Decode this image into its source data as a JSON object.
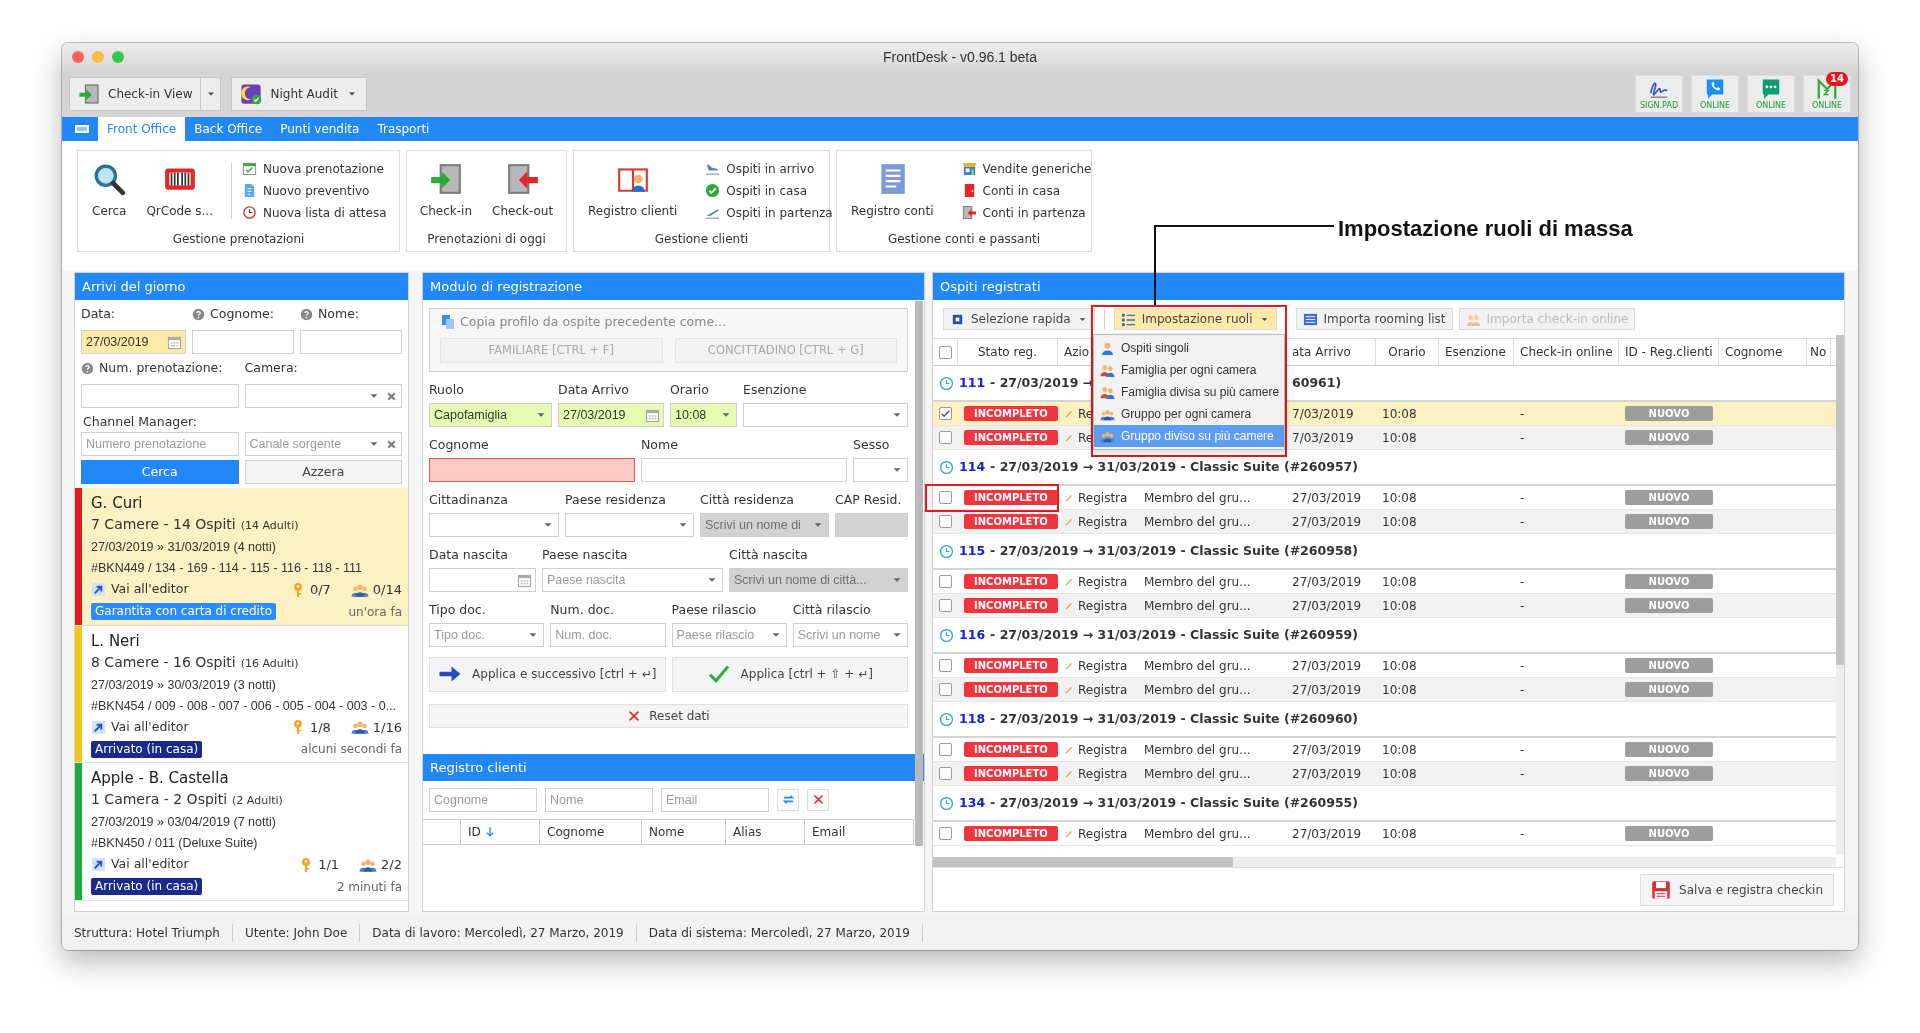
{
  "window": {
    "title": "FrontDesk - v0.96.1 beta"
  },
  "toolbar": {
    "left": [
      {
        "label": "Check-in View",
        "kind": "split"
      },
      {
        "label": "Night Audit",
        "kind": "dropdown"
      }
    ],
    "right": [
      {
        "label": "SIGN.PAD"
      },
      {
        "label": "ONLINE"
      },
      {
        "label": "ONLINE"
      },
      {
        "label": "ONLINE",
        "badge": "14"
      }
    ]
  },
  "tabs": [
    {
      "label": "Front Office",
      "selected": true
    },
    {
      "label": "Back Office",
      "selected": false
    },
    {
      "label": "Punti vendita",
      "selected": false
    },
    {
      "label": "Trasporti",
      "selected": false
    }
  ],
  "ribbon": [
    {
      "title": "Gestione prenotazioni",
      "large": [
        "Cerca",
        "QrCode s..."
      ],
      "small": [
        "Nuova prenotazione",
        "Nuovo preventivo",
        "Nuova lista di attesa"
      ]
    },
    {
      "title": "Prenotazioni di oggi",
      "large": [
        "Check-in",
        "Check-out"
      ]
    },
    {
      "title": "Gestione clienti",
      "large": [
        "Registro clienti"
      ],
      "small": [
        "Ospiti in arrivo",
        "Ospiti in casa",
        "Ospiti in partenza"
      ]
    },
    {
      "title": "Gestione conti e passanti",
      "large": [
        "Registro conti"
      ],
      "small": [
        "Vendite generiche",
        "Conti in casa",
        "Conti in partenza"
      ]
    }
  ],
  "annotation": {
    "text": "Impostazione ruoli di massa"
  },
  "arrivals": {
    "title": "Arrivi del giorno",
    "filters": [
      {
        "label": "Data:",
        "kind": "date",
        "value": "27/03/2019",
        "help": false,
        "highlighted": true
      },
      {
        "label": "Cognome:",
        "kind": "text",
        "help": true,
        "highlighted": false
      },
      {
        "label": "Nome:",
        "kind": "text",
        "help": true,
        "highlighted": false
      },
      {
        "label": "Num. prenotazione:",
        "kind": "text",
        "help": true,
        "highlighted": false
      },
      {
        "label": "Camera:",
        "kind": "select-clear",
        "help": false,
        "highlighted": false
      }
    ],
    "channel": {
      "label": "Channel Manager:",
      "fields": [
        {
          "kind": "text",
          "placeholder": "Numero prenotazione"
        },
        {
          "kind": "select-clear",
          "placeholder": "Canale sorgente"
        }
      ]
    },
    "buttons": [
      {
        "label": "Cerca",
        "primary": true
      },
      {
        "label": "Azzera",
        "primary": false
      }
    ],
    "bookings": [
      {
        "name": "G. Curi",
        "rooms": "7 Camere - 14 Ospiti",
        "adults": "(14 Adulti)",
        "dates": "27/03/2019 » 31/03/2019 (4 notti)",
        "booking": "#BKN449 / 134 - 169 - 114 - 115 - 116 - 118 - 111",
        "link": "Vai all'editor",
        "keys": "0/7",
        "guests": "0/14",
        "status": {
          "text": "Garantita con carta di credito",
          "color": "#2b8cff"
        },
        "ago": "un'ora fa",
        "color": "#e01b1b",
        "selected": true
      },
      {
        "name": "L. Neri",
        "rooms": "8 Camere - 16 Ospiti",
        "adults": "(16 Adulti)",
        "dates": "27/03/2019 » 30/03/2019 (3 notti)",
        "booking": "#BKN454 / 009 - 008 - 007 - 006 - 005 - 004 - 003 - 0...",
        "link": "Vai all'editor",
        "keys": "1/8",
        "guests": "1/16",
        "status": {
          "text": "Arrivato (in casa)",
          "color": "#1a2a8c"
        },
        "ago": "alcuni secondi fa",
        "color": "#f5c518",
        "selected": false
      },
      {
        "name": "Apple - B. Castella",
        "rooms": "1 Camera - 2 Ospiti",
        "adults": "(2 Adulti)",
        "dates": "27/03/2019 » 03/04/2019 (7 notti)",
        "booking": "#BKN450 / 011 (Deluxe Suite)",
        "link": "Vai all'editor",
        "keys": "1/1",
        "guests": "2/2",
        "status": {
          "text": "Arrivato (in casa)",
          "color": "#1a2a8c"
        },
        "ago": "2 minuti fa",
        "color": "#1faa3c",
        "selected": false
      }
    ]
  },
  "registration": {
    "title": "Modulo di registrazione",
    "copy_legend": "Copia profilo da ospite precedente come...",
    "copy_buttons": [
      {
        "label": "FAMILIARE [CTRL + F]",
        "disabled": true
      },
      {
        "label": "CONCITTADINO [CTRL + G]",
        "disabled": true
      }
    ],
    "rows": [
      {
        "fields": [
          {
            "label": "Ruolo",
            "kind": "select",
            "value": "Capofamiglia",
            "highlighted": true,
            "invalid": false,
            "disabled": false
          },
          {
            "label": "Data Arrivo",
            "kind": "date",
            "value": "27/03/2019",
            "highlighted": true,
            "invalid": false,
            "disabled": false
          },
          {
            "label": "Orario",
            "kind": "select",
            "value": "10:08",
            "highlighted": true,
            "invalid": false,
            "disabled": false
          },
          {
            "label": "Esenzione",
            "kind": "select",
            "highlighted": false,
            "invalid": false,
            "disabled": false
          }
        ]
      },
      {
        "fields": [
          {
            "label": "Cognome",
            "kind": "text",
            "highlighted": false,
            "invalid": true,
            "disabled": false
          },
          {
            "label": "Nome",
            "kind": "text",
            "highlighted": false,
            "invalid": false,
            "disabled": false
          },
          {
            "label": "Sesso",
            "kind": "select",
            "highlighted": false,
            "invalid": false,
            "disabled": false
          }
        ]
      },
      {
        "fields": [
          {
            "label": "Cittadinanza",
            "kind": "select",
            "highlighted": false,
            "invalid": false,
            "disabled": false
          },
          {
            "label": "Paese residenza",
            "kind": "select",
            "highlighted": false,
            "invalid": false,
            "disabled": false
          },
          {
            "label": "Città residenza",
            "kind": "select",
            "placeholder": "Scrivi un nome di",
            "highlighted": false,
            "invalid": false,
            "disabled": true
          },
          {
            "label": "CAP Resid.",
            "kind": "text",
            "highlighted": false,
            "invalid": false,
            "disabled": true
          }
        ]
      },
      {
        "fields": [
          {
            "label": "Data nascita",
            "kind": "date",
            "highlighted": false,
            "invalid": false,
            "disabled": false
          },
          {
            "label": "Paese nascita",
            "kind": "select",
            "placeholder": "Paese nascita",
            "highlighted": false,
            "invalid": false,
            "disabled": false
          },
          {
            "label": "Città nascita",
            "kind": "select",
            "placeholder": "Scrivi un nome di città...",
            "highlighted": false,
            "invalid": false,
            "disabled": true
          }
        ]
      },
      {
        "fields": [
          {
            "label": "Tipo doc.",
            "kind": "select",
            "placeholder": "Tipo doc.",
            "highlighted": false,
            "invalid": false,
            "disabled": false
          },
          {
            "label": "Num. doc.",
            "kind": "text",
            "placeholder": "Num. doc.",
            "highlighted": false,
            "invalid": false,
            "disabled": false
          },
          {
            "label": "Paese rilascio",
            "kind": "select",
            "placeholder": "Paese rilascio",
            "highlighted": false,
            "invalid": false,
            "disabled": false
          },
          {
            "label": "Città rilascio",
            "kind": "select",
            "placeholder": "Scrivi un nome",
            "highlighted": false,
            "invalid": false,
            "disabled": false
          }
        ]
      }
    ],
    "apply_buttons": [
      {
        "label": "Applica e successivo [ctrl + ↵]"
      },
      {
        "label": "Applica [ctrl + ⇧ + ↵]"
      }
    ],
    "reset": "Reset dati"
  },
  "clients": {
    "title": "Registro clienti",
    "filters": [
      {
        "placeholder": "Cognome"
      },
      {
        "placeholder": "Nome"
      },
      {
        "placeholder": "Email"
      }
    ],
    "columns": [
      "ID",
      "Cognome",
      "Nome",
      "Alias",
      "Email"
    ]
  },
  "guests": {
    "title": "Ospiti registrati",
    "toolbar": [
      {
        "label": "Selezione rapida",
        "kind": "dropdown",
        "open": false,
        "disabled": false
      },
      {
        "label": "Impostazione ruoli",
        "kind": "dropdown",
        "open": true,
        "disabled": false
      },
      {
        "label": "Importa rooming list",
        "kind": "button",
        "open": false,
        "disabled": false
      },
      {
        "label": "Importa check-in online",
        "kind": "button",
        "open": false,
        "disabled": true
      }
    ],
    "role_menu": [
      {
        "label": "Ospiti singoli",
        "selected": false
      },
      {
        "label": "Famiglia per ogni camera",
        "selected": false
      },
      {
        "label": "Famiglia divisa su più camere",
        "selected": false
      },
      {
        "label": "Gruppo per ogni camera",
        "selected": false
      },
      {
        "label": "Gruppo diviso su più camere",
        "selected": true
      }
    ],
    "select_all": false,
    "columns": [
      "Stato reg.",
      "Azio",
      "ata Arrivo",
      "Orario",
      "Esenzione",
      "Check-in online",
      "ID - Reg.clienti",
      "Cognome",
      "No"
    ],
    "groups": [
      {
        "room": "111",
        "title": "- 27/03/2019 →",
        "title_tail": "60961)",
        "rows": [
          {
            "checked": true,
            "selected": true,
            "status": "INCOMPLETO",
            "action": "Re",
            "date": "7/03/2019",
            "time": "10:08",
            "checkin": "-",
            "id": "NUOVO"
          },
          {
            "checked": false,
            "selected": false,
            "status": "INCOMPLETO",
            "action": "Re",
            "date": "7/03/2019",
            "time": "10:08",
            "checkin": "-",
            "id": "NUOVO"
          }
        ]
      },
      {
        "room": "114",
        "title": "- 27/03/2019 → 31/03/2019 - Classic Suite (#260957)",
        "rows": [
          {
            "checked": false,
            "selected": false,
            "status": "INCOMPLETO",
            "action": "Registra",
            "role": "Membro del gru...",
            "date": "27/03/2019",
            "time": "10:08",
            "checkin": "-",
            "id": "NUOVO"
          },
          {
            "checked": false,
            "selected": false,
            "status": "INCOMPLETO",
            "action": "Registra",
            "role": "Membro del gru...",
            "date": "27/03/2019",
            "time": "10:08",
            "checkin": "-",
            "id": "NUOVO"
          }
        ]
      },
      {
        "room": "115",
        "title": "- 27/03/2019 → 31/03/2019 - Classic Suite (#260958)",
        "rows": [
          {
            "checked": false,
            "selected": false,
            "status": "INCOMPLETO",
            "action": "Registra",
            "role": "Membro del gru...",
            "date": "27/03/2019",
            "time": "10:08",
            "checkin": "-",
            "id": "NUOVO"
          },
          {
            "checked": false,
            "selected": false,
            "status": "INCOMPLETO",
            "action": "Registra",
            "role": "Membro del gru...",
            "date": "27/03/2019",
            "time": "10:08",
            "checkin": "-",
            "id": "NUOVO"
          }
        ]
      },
      {
        "room": "116",
        "title": "- 27/03/2019 → 31/03/2019 - Classic Suite (#260959)",
        "rows": [
          {
            "checked": false,
            "selected": false,
            "status": "INCOMPLETO",
            "action": "Registra",
            "role": "Membro del gru...",
            "date": "27/03/2019",
            "time": "10:08",
            "checkin": "-",
            "id": "NUOVO"
          },
          {
            "checked": false,
            "selected": false,
            "status": "INCOMPLETO",
            "action": "Registra",
            "role": "Membro del gru...",
            "date": "27/03/2019",
            "time": "10:08",
            "checkin": "-",
            "id": "NUOVO"
          }
        ]
      },
      {
        "room": "118",
        "title": "- 27/03/2019 → 31/03/2019 - Classic Suite (#260960)",
        "rows": [
          {
            "checked": false,
            "selected": false,
            "status": "INCOMPLETO",
            "action": "Registra",
            "role": "Membro del gru...",
            "date": "27/03/2019",
            "time": "10:08",
            "checkin": "-",
            "id": "NUOVO"
          },
          {
            "checked": false,
            "selected": false,
            "status": "INCOMPLETO",
            "action": "Registra",
            "role": "Membro del gru...",
            "date": "27/03/2019",
            "time": "10:08",
            "checkin": "-",
            "id": "NUOVO"
          }
        ]
      },
      {
        "room": "134",
        "title": "- 27/03/2019 → 31/03/2019 - Classic Suite (#260955)",
        "rows": [
          {
            "checked": false,
            "selected": false,
            "status": "INCOMPLETO",
            "action": "Registra",
            "role": "Membro del gru...",
            "date": "27/03/2019",
            "time": "10:08",
            "checkin": "-",
            "id": "NUOVO"
          }
        ]
      }
    ],
    "save_button": "Salva e registra checkin"
  },
  "status_bar": [
    "Struttura: Hotel Triumph",
    "Utente: John Doe",
    "Data di lavoro: Mercoledì, 27 Marzo, 2019",
    "Data di sistema: Mercoledì, 27 Marzo, 2019"
  ]
}
